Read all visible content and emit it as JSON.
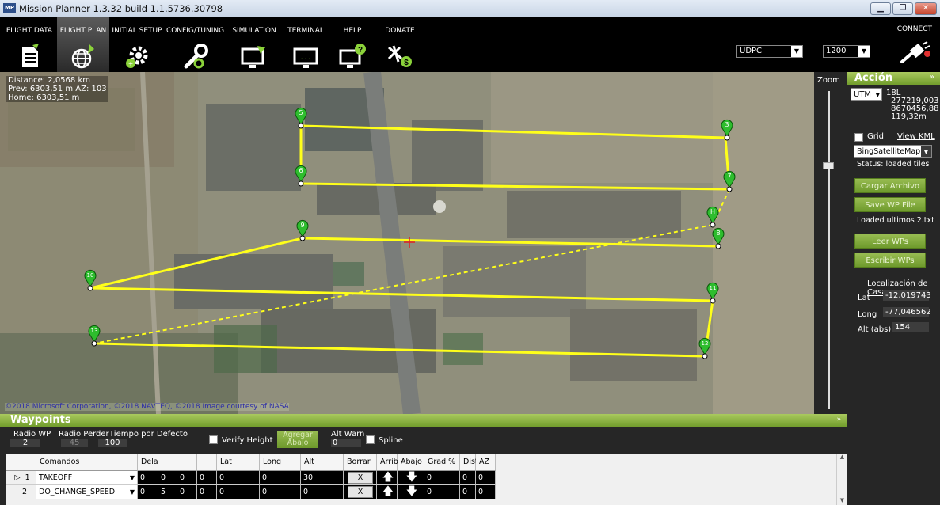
{
  "window": {
    "title": "Mission Planner 1.3.32 build 1.1.5736.30798"
  },
  "menu": {
    "items": [
      {
        "label": "FLIGHT DATA",
        "icon": "flight-data-icon"
      },
      {
        "label": "FLIGHT PLAN",
        "icon": "flight-plan-icon"
      },
      {
        "label": "INITIAL SETUP",
        "icon": "initial-setup-icon"
      },
      {
        "label": "CONFIG/TUNING",
        "icon": "config-tuning-icon"
      },
      {
        "label": "SIMULATION",
        "icon": "simulation-icon"
      },
      {
        "label": "TERMINAL",
        "icon": "terminal-icon"
      },
      {
        "label": "HELP",
        "icon": "help-icon"
      },
      {
        "label": "DONATE",
        "icon": "donate-icon"
      }
    ],
    "connection": "UDPCI",
    "baud": "1200",
    "connect": "CONNECT"
  },
  "map": {
    "info": [
      "Distance: 2,0568 km",
      "Prev: 6303,51 m AZ: 103",
      "Home: 6303,51 m"
    ],
    "copyright": "©2018 Microsoft Corporation, ©2018 NAVTEQ, ©2018 Image courtesy of NASA",
    "waypoints": [
      "5",
      "3",
      "6",
      "7",
      "H",
      "9",
      "8",
      "10",
      "11",
      "13",
      "12"
    ],
    "path_color": "#ffff1a",
    "marker_color": "#2ebd2e"
  },
  "zoom": {
    "label": "Zoom"
  },
  "accion": {
    "title": "Acción",
    "collapse": "»",
    "coord_type": "UTM",
    "utm": [
      "18L",
      "277219,003",
      "8670456,88",
      "119,32m"
    ],
    "grid_label": "Grid",
    "view_kml": "View KML",
    "map_type": "BingSatelliteMap",
    "status": "Status: loaded tiles",
    "cargar": "Cargar Archivo WP",
    "save": "Save WP File",
    "loaded": "Loaded ultimos 2.txt",
    "leer": "Leer WPs",
    "escribir": "Escribir WPs",
    "home_title": "Localización de Casa",
    "lat_label": "Lat",
    "lat": "-12,019743",
    "long_label": "Long",
    "long": "-77,046562",
    "alt_label": "Alt (abs)",
    "alt": "154"
  },
  "waypoints": {
    "title": "Waypoints",
    "collapse": "»",
    "radio_wp_label": "Radio WP",
    "radio_wp": "2",
    "radio_perder_label": "Radio Perder",
    "radio_perder": "45",
    "tiempo_label": "Tiempo  por Defecto",
    "tiempo": "100",
    "verify_height": "Verify Height",
    "agregar": [
      "Agregar",
      "Abajo"
    ],
    "alt_warn_label": "Alt Warn",
    "alt_warn": "0",
    "spline": "Spline",
    "columns": [
      "",
      "Comandos",
      "Dela",
      "",
      "",
      "",
      "Lat",
      "Long",
      "Alt",
      "Borrar",
      "Arrib",
      "Abajo",
      "Grad %",
      "Dist",
      "AZ"
    ],
    "rows": [
      {
        "marker": "▷",
        "num": "1",
        "cmd": "TAKEOFF",
        "p": [
          "0",
          "0",
          "0",
          "0"
        ],
        "lat": "0",
        "long": "0",
        "alt": "30",
        "del": "X",
        "grad": "0",
        "dist": "0",
        "az": "0"
      },
      {
        "marker": "",
        "num": "2",
        "cmd": "DO_CHANGE_SPEED",
        "p": [
          "0",
          "5",
          "0",
          "0"
        ],
        "lat": "0",
        "long": "0",
        "alt": "0",
        "del": "X",
        "grad": "0",
        "dist": "0",
        "az": "0"
      }
    ]
  }
}
